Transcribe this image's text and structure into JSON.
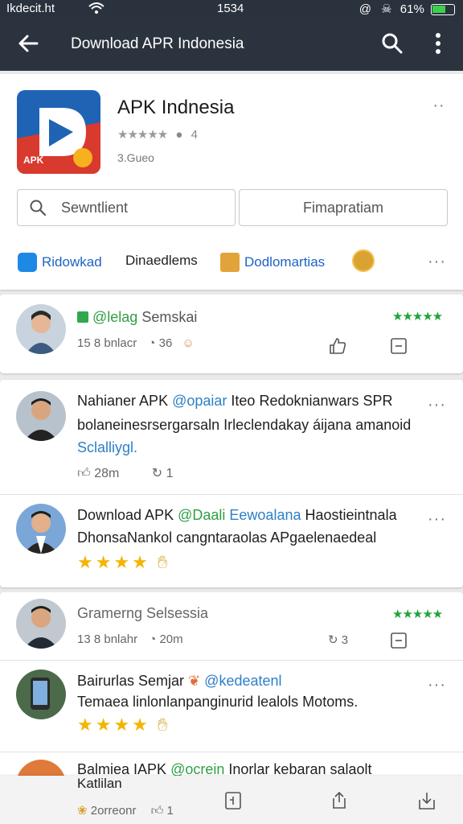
{
  "status_bar": {
    "carrier": "Ikdecit.ht",
    "time": "1534",
    "battery": "61%"
  },
  "app_bar": {
    "title": "Download APR Indonesia",
    "back_icon": "arrow-left-icon",
    "search_icon": "search-icon",
    "menu_icon": "more-vert-icon"
  },
  "app": {
    "name": "APK Indnesia",
    "icon_text": "APK",
    "stars": "★★★★★",
    "rating_count": "4",
    "size": "3.Gueo",
    "search_button": "Sewntlient",
    "secondary_button": "Fimapratiam"
  },
  "chips": [
    {
      "label": "Ridowkad",
      "color": "#1e88e5"
    },
    {
      "label": "Dinaedlems",
      "color": "#222222"
    },
    {
      "label": "Dodlomartias",
      "color": "#1e63c4"
    }
  ],
  "reviews": [
    {
      "badge": "@lelag",
      "name": "Semskai",
      "stars": "★★★★★",
      "date": "15 8 bnlacr",
      "comments": "36",
      "type": "compact"
    },
    {
      "name": "Nahianer APK",
      "handle": "@opaiar",
      "title_rest": "Iteo Redoknianwars SPR",
      "body": "bolaneinesrsergarsaln Irleclendakay áijana amanoid",
      "body2": "Sclalliygl.",
      "likes": "28m",
      "shares": "1"
    },
    {
      "name": "Download APK",
      "handle": "@Daali",
      "handle2": "Eewoalana",
      "title_rest": "Haostieintnala",
      "body": "DhonsaNankol cangntaraolas APgaelenaedeal",
      "stars": "★★★★"
    },
    {
      "name": "Gramerng Selsessia",
      "stars": "★★★★★",
      "date": "13 8 bnlahr",
      "comments": "20m",
      "shares": "3",
      "type": "compact"
    },
    {
      "name": "Bairurlas Semjar",
      "handle": "@kedeatenl",
      "body": "Temaea linlonlanpanginurid lealols Motoms.",
      "stars": "★★★★"
    },
    {
      "name": "Balmiea IAPK",
      "handle": "@ocrein",
      "title_rest": "Inorlar kebaran salaolt",
      "body": "Katlilan",
      "date": "2orreonr",
      "likes": "1"
    }
  ]
}
